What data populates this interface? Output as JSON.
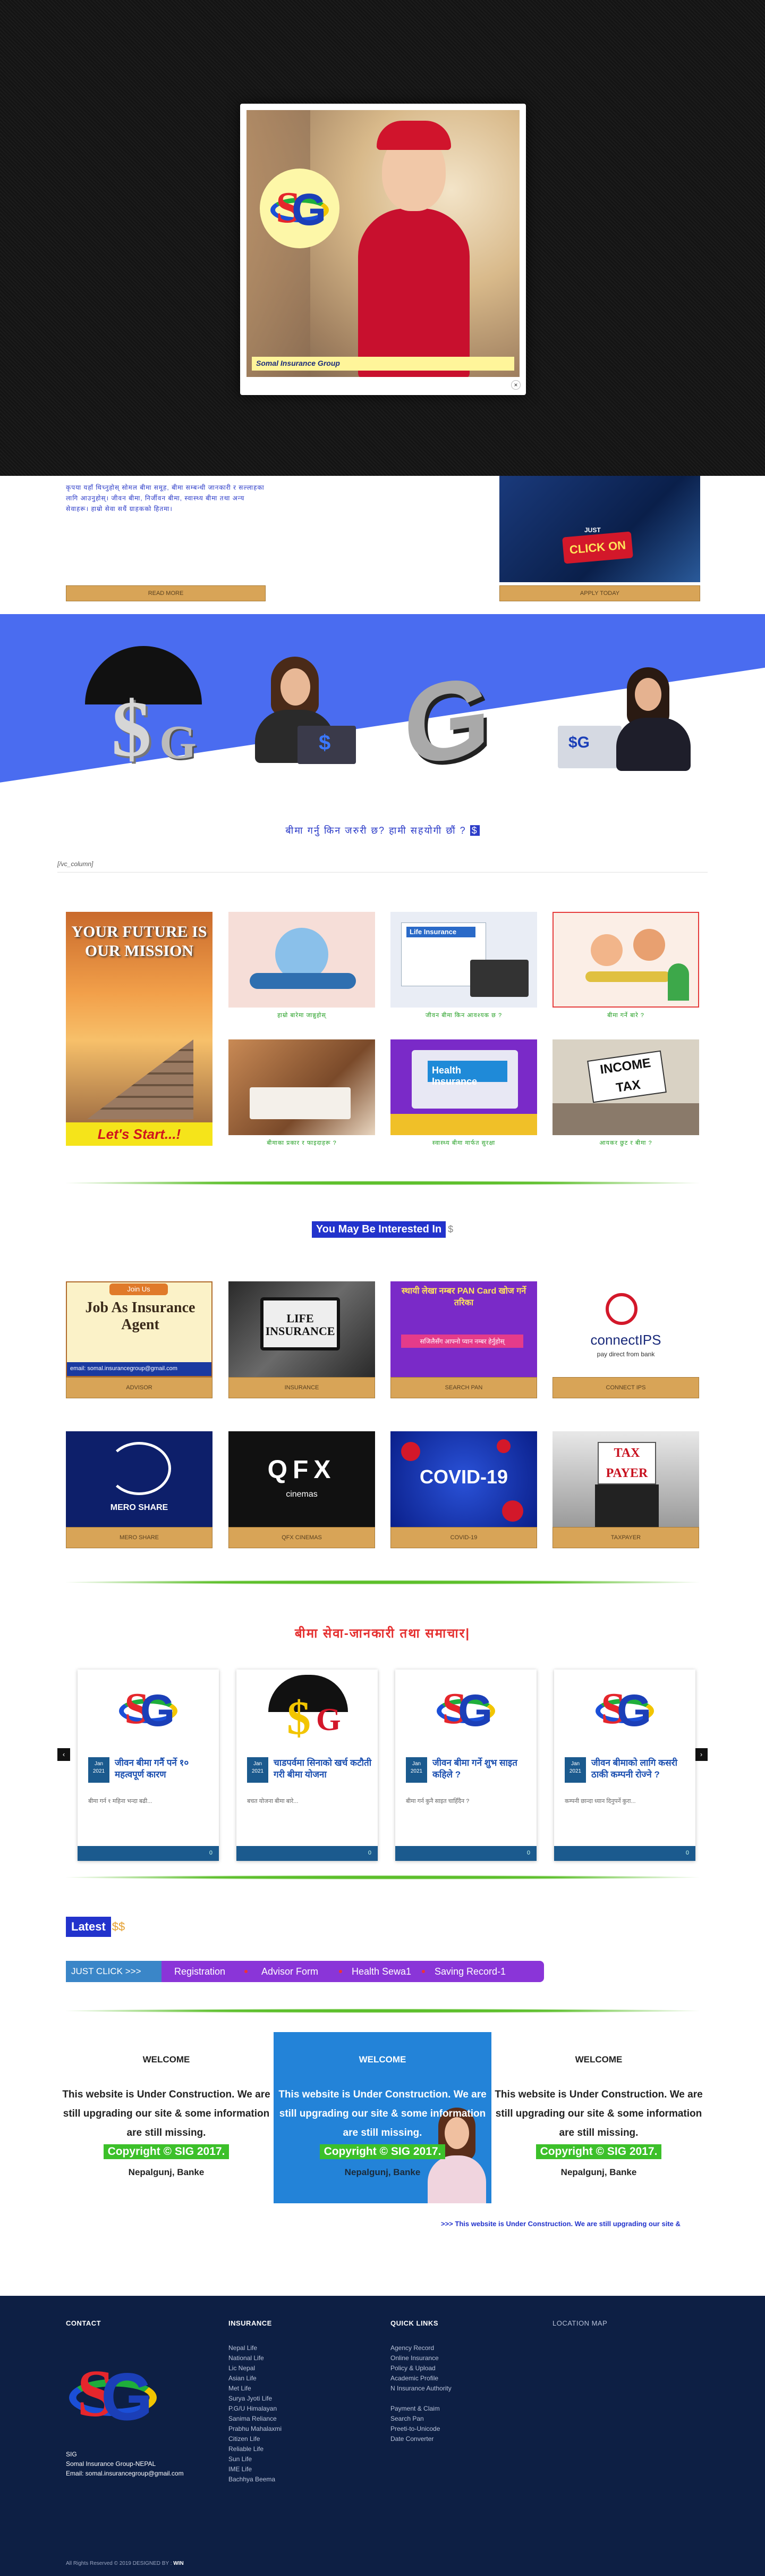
{
  "popup": {
    "caption": "Somal Insurance Group",
    "close": "×"
  },
  "about": {
    "text": "कृपया यहाँ थिच्नुहोस् सोमल बीमा समूह, बीमा सम्बन्धी जानकारी र सल्लाहका लागि आउनुहोस्। जीवन बीमा, निर्जीवन बीमा, स्वास्थ्य बीमा तथा अन्य सेवाहरू। हाम्रो सेवा सधैं ग्राहकको हितमा।",
    "read_more": "READ MORE",
    "image_text_just": "JUST",
    "image_text_click": "CLICK ON",
    "apply_today": "APPLY TODAY"
  },
  "hero": {
    "dollar": "$",
    "g": "G",
    "sg": "$G"
  },
  "section_about_question": "बीमा गर्नु किन जरुरी छ? हामी सहयोगी छौं ?",
  "section_about_dollar": "$",
  "vc_column": "[/vc_column]",
  "mission": {
    "title": "YOUR FUTURE IS OUR MISSION",
    "cta": "Let's Start...!"
  },
  "grid_captions": [
    "हाम्रो बारेमा जान्नुहोस्",
    "जीवन बीमा किन आवश्यक छ ?",
    "बीमा गर्ने बारे ?",
    "बीमाका प्रकार र फाइदाहरू ?",
    "स्वास्थ्य बीमा मार्फत सुरक्षा",
    "आयकर छुट र बीमा ?"
  ],
  "grid_images": {
    "life": "Life Insurance",
    "health": "Health Insurance",
    "tax": "INCOME TAX"
  },
  "interested": {
    "label": "You May Be Interested In",
    "dollar": "$"
  },
  "cards": [
    {
      "label": "ADVISOR",
      "img_top": "Join Us",
      "img_main": "Job As Insurance Agent",
      "img_email": "email: somal.insurancegroup@gmail.com"
    },
    {
      "label": "INSURANCE",
      "img_main": "LIFE INSURANCE"
    },
    {
      "label": "SEARCH PAN",
      "img_main": "स्थायी लेखा नम्बर PAN Card खोज गर्ने तरिका",
      "img_sub": "सजिलैसँग आफ्नो प्यान नम्बर हेर्नुहोस्"
    },
    {
      "label": "CONNECT IPS",
      "img_main": "connectIPS",
      "img_sub": "pay direct from bank"
    },
    {
      "label": "MERO SHARE",
      "img_main": "MERO SHARE"
    },
    {
      "label": "QFX Cinemas",
      "img_main": "QFX",
      "img_sub": "cinemas"
    },
    {
      "label": "COVID-19",
      "img_main": "COVID-19"
    },
    {
      "label": "TAXPAYER",
      "img_main": "TAX PAYER"
    }
  ],
  "news_heading": "बीमा सेवा-जानकारी तथा समाचार|",
  "slider": {
    "prev": "‹",
    "next": "›",
    "items": [
      {
        "date": "Jan 2021",
        "title": "जीवन बीमा गर्नै पर्ने १० महत्वपूर्ण कारण",
        "excerpt": "बीमा गर्न १ महिना भन्दा बढी...",
        "meta": "0"
      },
      {
        "date": "Jan 2021",
        "title": "चाडपर्वमा सिनाको खर्च कटौती गरी बीमा योजना",
        "excerpt": "बचत योजना बीमा बारे...",
        "meta": "0"
      },
      {
        "date": "Jan 2021",
        "title": "जीवन बीमा गर्ने शुभ साइत कहिले ?",
        "excerpt": "बीमा गर्न कुनै साइत चाहिँदैन ?",
        "meta": "0"
      },
      {
        "date": "Jan 2021",
        "title": "जीवन बीमाको लागि कसरी ठाकी कम्पनी रोज्ने ?",
        "excerpt": "कम्पनी छान्दा ध्यान दिनुपर्ने कुरा...",
        "meta": "0"
      }
    ]
  },
  "latest": {
    "label": "Latest",
    "dollar": "$$",
    "lead": "JUST CLICK >>>",
    "items": [
      "Registration",
      "Advisor Form",
      "Health Sewa1",
      "Saving Record-1"
    ]
  },
  "welcome": [
    {
      "title": "WELCOME",
      "text": "This website is Under Construction. We are still upgrading our site & some information are still missing.",
      "copyright": "Copyright © SIG 2017.",
      "city": "Nepalgunj, Banke"
    },
    {
      "title": "WELCOME",
      "text": "This website is Under Construction. We are still upgrading our site & some information are still missing.",
      "copyright": "Copyright © SIG 2017.",
      "city": "Nepalgunj, Banke"
    },
    {
      "title": "WELCOME",
      "text": "This website is Under Construction. We are still upgrading our site & some information are still missing.",
      "copyright": "Copyright © SIG 2017.",
      "city": "Nepalgunj, Banke"
    }
  ],
  "marquee": ">>> This website is Under Construction. We are still upgrading our site &",
  "footer": {
    "contact": {
      "title": "CONTACT",
      "name": "SIG",
      "org": "Somal Insurance Group-NEPAL",
      "email": "Email: somal.insurancegroup@gmail.com"
    },
    "insurance": {
      "title": "INSURANCE",
      "items": [
        "Nepal Life",
        "National Life",
        "Lic Nepal",
        "Asian Life",
        "Met Life",
        "Surya Jyoti Life",
        "P.G/U Himalayan",
        "Sanima Reliance",
        "Prabhu Mahalaxmi",
        "Citizen Life",
        "Reliable Life",
        "Sun Life",
        "IME Life",
        "Bachhya Beema"
      ]
    },
    "quick": {
      "title": "QUICK LINKS",
      "group1": [
        "Agency Record",
        "Online Insurance",
        "Policy & Upload",
        "Academic Profile",
        "N Insurance Authority"
      ],
      "group2": [
        "Payment & Claim",
        "Search Pan",
        "Preeti-to-Unicode",
        "Date Converter"
      ]
    },
    "map": {
      "title": "LOCATION MAP"
    },
    "bottom_prefix": "All Rights Reserved © 2019 DESIGNED BY : ",
    "bottom_brand": "WIN"
  },
  "colors": {
    "brand_blue": "#2233cc",
    "tan": "#d8a457",
    "footer_bg": "#0d1f44",
    "latest_bar": "#8a35d8"
  }
}
